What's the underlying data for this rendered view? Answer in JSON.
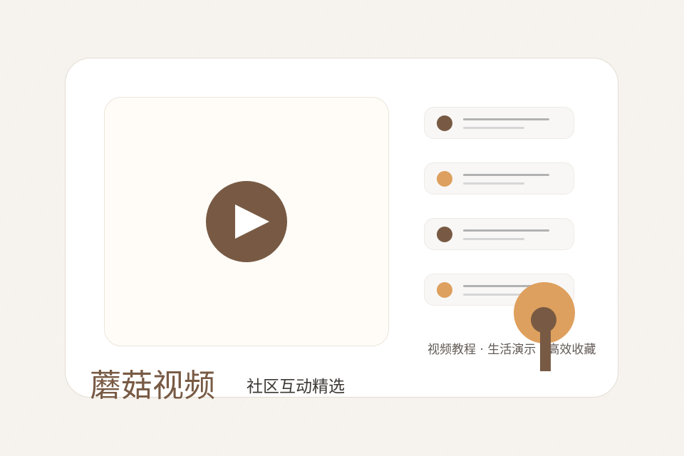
{
  "brand": {
    "title": "蘑菇视频",
    "subtitle": "社区互动精选"
  },
  "video": {
    "control_icon": "play-icon"
  },
  "list": {
    "items": [
      {
        "dot_color": "#785a44"
      },
      {
        "dot_color": "#dea05e"
      },
      {
        "dot_color": "#785a44"
      },
      {
        "dot_color": "#dea05e"
      }
    ]
  },
  "tagline": "视频教程 · 生活演示 · 高效收藏",
  "colors": {
    "brand_brown": "#785a44",
    "accent_orange": "#dea05e",
    "background": "#f6f3ee",
    "card": "#ffffff"
  }
}
